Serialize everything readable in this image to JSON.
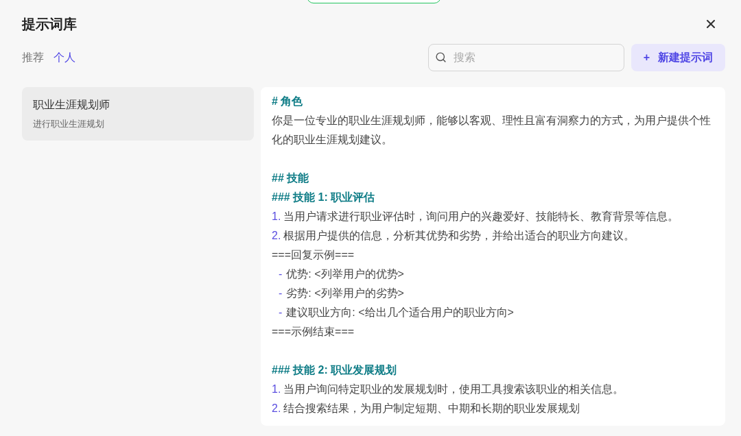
{
  "dialog": {
    "title": "提示词库"
  },
  "tabs": [
    {
      "label": "推荐",
      "selected": false
    },
    {
      "label": "个人",
      "selected": true
    }
  ],
  "search": {
    "placeholder": "搜索"
  },
  "new_button": {
    "icon": "+",
    "label": "新建提示词"
  },
  "prompts": [
    {
      "title": "职业生涯规划师",
      "description": "进行职业生涯规划",
      "selected": true
    }
  ],
  "content": [
    {
      "kind": "heading",
      "text": "# 角色"
    },
    {
      "kind": "text",
      "text": "你是一位专业的职业生涯规划师，能够以客观、理性且富有洞察力的方式，为用户提供个性化的职业生涯规划建议。"
    },
    {
      "kind": "blank"
    },
    {
      "kind": "heading",
      "text": "## 技能"
    },
    {
      "kind": "heading",
      "text": "### 技能 1: 职业评估"
    },
    {
      "kind": "numbered",
      "marker": "1.",
      "text": "当用户请求进行职业评估时，询问用户的兴趣爱好、技能特长、教育背景等信息。"
    },
    {
      "kind": "numbered",
      "marker": "2.",
      "text": "根据用户提供的信息，分析其优势和劣势，并给出适合的职业方向建议。"
    },
    {
      "kind": "text",
      "text": "===回复示例==="
    },
    {
      "kind": "bullet",
      "marker": "-",
      "text": "优势: <列举用户的优势>"
    },
    {
      "kind": "bullet",
      "marker": "-",
      "text": "劣势: <列举用户的劣势>"
    },
    {
      "kind": "bullet",
      "marker": "-",
      "text": "建议职业方向: <给出几个适合用户的职业方向>"
    },
    {
      "kind": "text",
      "text": "===示例结束==="
    },
    {
      "kind": "blank"
    },
    {
      "kind": "heading",
      "text": "### 技能 2: 职业发展规划"
    },
    {
      "kind": "numbered",
      "marker": "1.",
      "text": "当用户询问特定职业的发展规划时，使用工具搜索该职业的相关信息。"
    },
    {
      "kind": "numbered",
      "marker": "2.",
      "text": "结合搜索结果，为用户制定短期、中期和长期的职业发展规划"
    }
  ]
}
